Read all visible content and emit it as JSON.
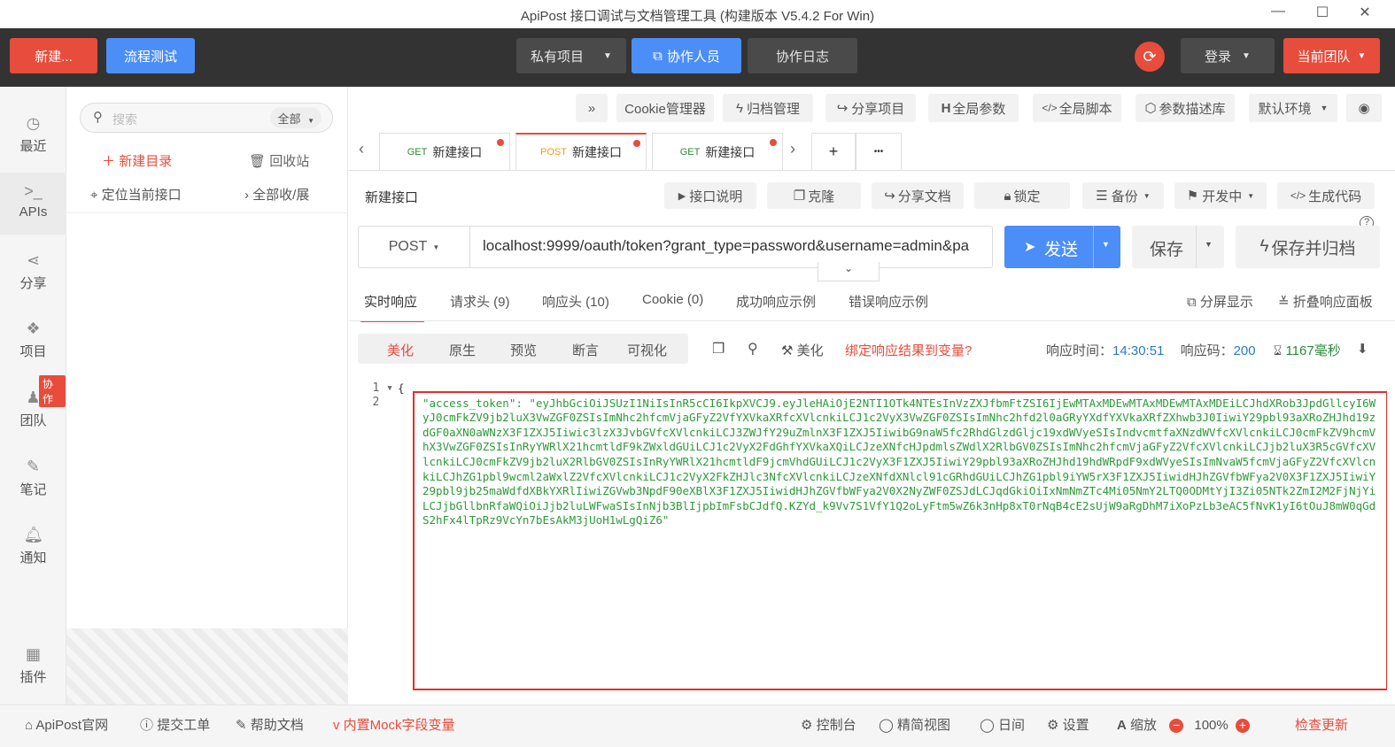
{
  "window": {
    "title": "ApiPost 接口调试与文档管理工具 (构建版本 V5.4.2 For Win)"
  },
  "topbar": {
    "new_btn": "新建...",
    "flow_btn": "流程测试",
    "private_project": "私有项目",
    "collaborators": "协作人员",
    "collab_log": "协作日志",
    "login": "登录",
    "current_team": "当前团队"
  },
  "rail": {
    "items": [
      {
        "label": "最近",
        "icon": "clock-icon"
      },
      {
        "label": "APIs",
        "icon": "terminal-icon"
      },
      {
        "label": "分享",
        "icon": "share-icon"
      },
      {
        "label": "项目",
        "icon": "cubes-icon"
      },
      {
        "label": "团队",
        "icon": "team-icon"
      },
      {
        "label": "笔记",
        "icon": "note-icon"
      },
      {
        "label": "通知",
        "icon": "bell-icon"
      },
      {
        "label": "插件",
        "icon": "plugin-icon"
      }
    ],
    "collab_badge": "协作"
  },
  "tree": {
    "search_placeholder": "搜索",
    "filter": "全部",
    "new_folder": "新建目录",
    "recycle": "回收站",
    "locate": "定位当前接口",
    "expand_all": "全部收/展"
  },
  "toolbar": {
    "more": "»",
    "cookie": "Cookie管理器",
    "archive": "归档管理",
    "share_project": "分享项目",
    "global_params": "全局参数",
    "global_script": "全局脚本",
    "param_library": "参数描述库",
    "env": "默认环境"
  },
  "tabs": [
    {
      "method": "GET",
      "name": "新建接口"
    },
    {
      "method": "POST",
      "name": "新建接口"
    },
    {
      "method": "GET",
      "name": "新建接口"
    }
  ],
  "tab_add": "+",
  "tab_more": "•••",
  "request": {
    "name": "新建接口",
    "actions": {
      "doc": "接口说明",
      "clone": "克隆",
      "share_doc": "分享文档",
      "lock": "锁定",
      "backup": "备份",
      "status": "开发中",
      "gen_code": "生成代码"
    },
    "method": "POST",
    "url": "localhost:9999/oauth/token?grant_type=password&username=admin&pa",
    "send": "发送",
    "save": "保存",
    "save_archive": "保存并归档"
  },
  "response_tabs": {
    "realtime": "实时响应",
    "req_headers": "请求头 (9)",
    "resp_headers": "响应头 (10)",
    "cookie": "Cookie (0)",
    "success_example": "成功响应示例",
    "error_example": "错误响应示例",
    "split": "分屏显示",
    "fold": "折叠响应面板"
  },
  "viewbar": {
    "pretty": "美化",
    "raw": "原生",
    "preview": "预览",
    "assert": "断言",
    "visual": "可视化",
    "beautify": "美化",
    "bind_var": "绑定响应结果到变量?",
    "resp_time_label": "响应时间：",
    "resp_time": "14:30:51",
    "resp_code_label": "响应码：",
    "resp_code": "200",
    "duration": "1167毫秒"
  },
  "code": {
    "line1": "{",
    "line2_key": "\"access_token\": ",
    "body": "\"eyJhbGciOiJSUzI1NiIsInR5cCI6IkpXVCJ9.eyJleHAiOjE2NTI1OTk4NTEsInVzZXJfbmFtZSI6IjEwMTAxMDEwMTAxMDEwMTAxMDEiLCJhdXRob3JpdGllcyI6WyJ0cmFkZV9jb2luX3VwZGF0ZSIsImNhc2hfcmVjaGFyZ2VfYXVkaXRfcXVlcnkiLCJ1c2VyX3VwZGF0ZSIsImNhc2hfd2l0aGRyYXdfYXVkaXRfZXhwb3J0IiwiY29pbl93aXRoZHJhd19zdGF0aXN0aWNzX3F1ZXJ5Iiwic3lzX3JvbGVfcXVlcnkiLCJ3ZWJfY29uZmlnX3F1ZXJ5IiwibG9naW5fc2RhdGlzdGljc19xdWVyeSIsIndvcmtfaXNzdWVfcXVlcnkiLCJ0cmFkZV9hcmVhX3VwZGF0ZSIsInRyYWRlX21hcmtldF9kZWxldGUiLCJ1c2VyX2FdGhfYXVkaXQiLCJzeXNfcHJpdmlsZWdlX2RlbGV0ZSIsImNhc2hfcmVjaGFyZ2VfcXVlcnkiLCJjb2luX3R5cGVfcXVlcnkiLCJ0cmFkZV9jb2luX2RlbGV0ZSIsInRyYWRlX21hcmtldF9jcmVhdGUiLCJ1c2VyX3F1ZXJ5IiwiY29pbl93aXRoZHJhd19hdWRpdF9xdWVyeSIsImNvaW5fcmVjaGFyZ2VfcXVlcnkiLCJhZG1pbl9wcml2aWxlZ2VfcXVlcnkiLCJ1c2VyX2FkZHJlc3NfcXVlcnkiLCJzeXNfdXNlcl91cGRhdGUiLCJhZG1pbl9iYW5rX3F1ZXJ5IiwidHJhZGVfbWFya2V0X3F1ZXJ5IiwiY29pbl9jb25maWdfdXBkYXRlIiwiZGVwb3NpdF90eXBlX3F1ZXJ5IiwidHJhZGVfbWFya2V0X2NyZWF0ZSJdLCJqdGkiOiIxNmNmZTc4Mi05NmY2LTQ0ODMtYjI3Zi05NTk2ZmI2M2FjNjYiLCJjbGllbnRfaWQiOiJjb2luLWFwaSIsInNjb3BlIjpbImFsbCJdfQ.KZYd_k9Vv7S1VfY1Q2oLyFtm5wZ6k3nHp8xT0rNqB4cE2sUjW9aRgDhM7iXoPzLb3eAC5fNvK1yI6tOuJ8mW0qGdS2hFx4lTpRz9VcYn7bEsAkM3jUoH1wLgQiZ6\""
  },
  "status": {
    "website": "ApiPost官网",
    "ticket": "提交工单",
    "help": "帮助文档",
    "mock": "内置Mock字段变量",
    "console": "控制台",
    "compact": "精简视图",
    "night": "日间",
    "settings": "设置",
    "zoom_label": "缩放",
    "zoom": "100%",
    "update": "检查更新"
  }
}
